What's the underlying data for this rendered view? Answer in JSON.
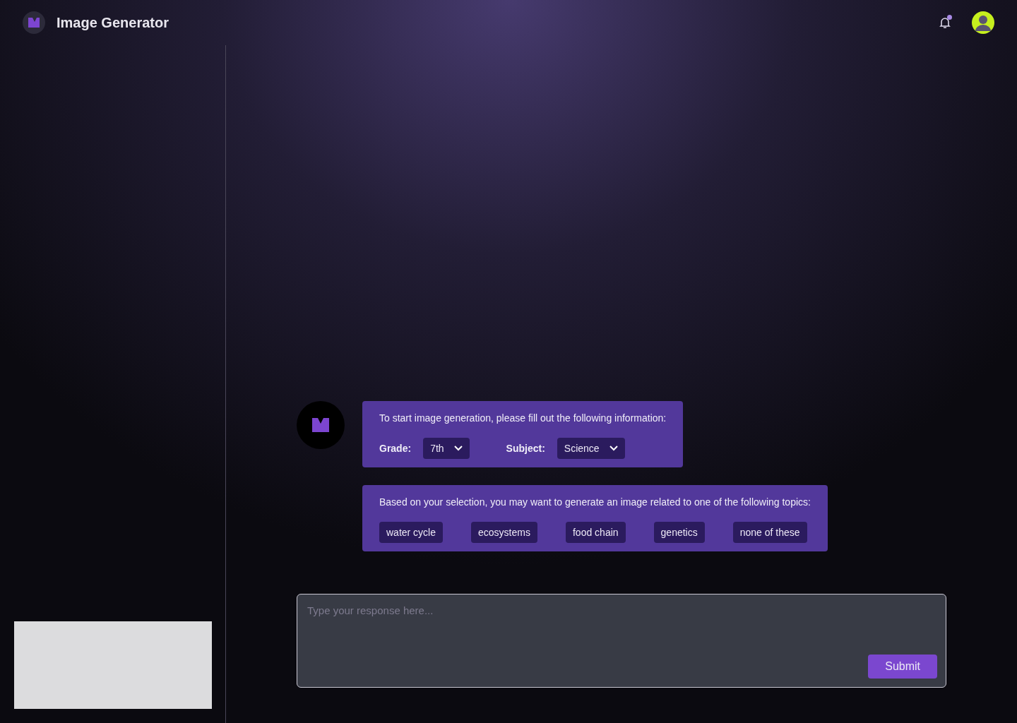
{
  "header": {
    "title": "Image Generator",
    "notification_dot": true
  },
  "messages": [
    {
      "kind": "form",
      "text": "To start image generation, please fill out the following information:",
      "fields": [
        {
          "label": "Grade:",
          "value": "7th"
        },
        {
          "label": "Subject:",
          "value": "Science"
        }
      ]
    },
    {
      "kind": "topics",
      "text": "Based on your selection, you may want to generate an image related to one of the following topics:",
      "options": [
        "water cycle",
        "ecosystems",
        "food chain",
        "genetics",
        "none of these"
      ]
    }
  ],
  "composer": {
    "placeholder": "Type your response here...",
    "button": "Submit"
  }
}
